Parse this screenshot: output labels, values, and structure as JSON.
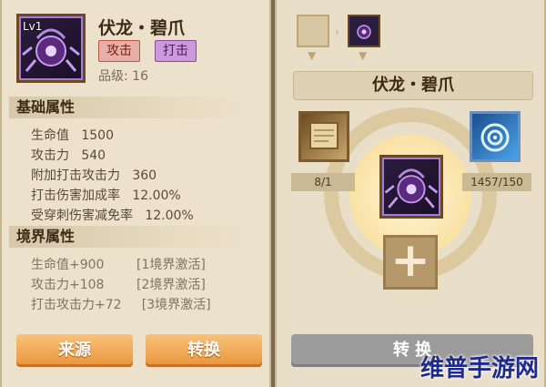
{
  "left": {
    "item_level": "Lv1",
    "item_name": "伏龙・碧爪",
    "tags": [
      "攻击",
      "打击"
    ],
    "grade": "品级: 16",
    "basic_section": "基础属性",
    "basic_stats": [
      "生命值   1500",
      "攻击力   540",
      "附加打击攻击力   360",
      "打击伤害加成率   12.00%",
      "受穿刺伤害减免率   12.00%"
    ],
    "realm_section": "境界属性",
    "realm_stats": [
      "生命值+900        [1境界激活]",
      "攻击力+108        [2境界激活]",
      "打击攻击力+72     [3境界激活]"
    ],
    "buttons": {
      "source": "来源",
      "convert": "转换"
    }
  },
  "right": {
    "item_name": "伏龙・碧爪",
    "material1_count": "8/1",
    "material2_count": "1457/150",
    "convert_button": "转 换"
  },
  "watermark": "维普手游网"
}
